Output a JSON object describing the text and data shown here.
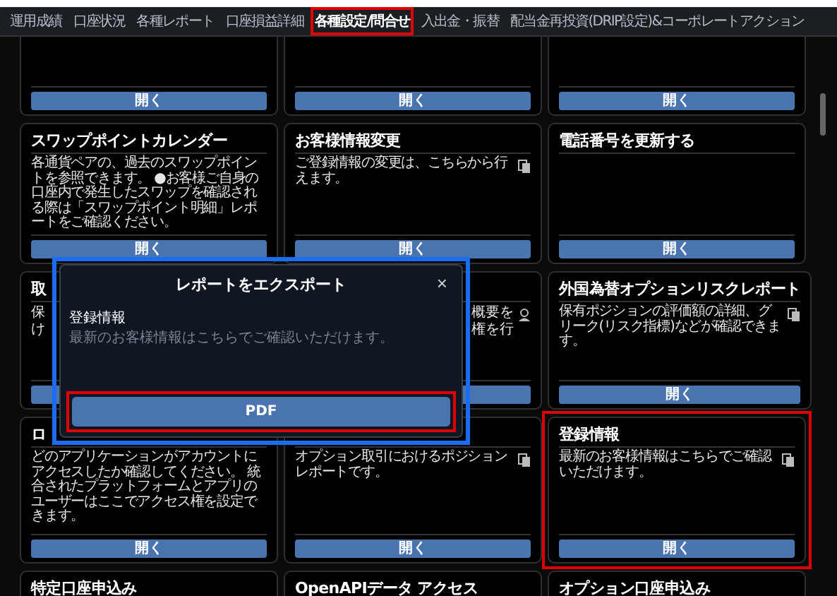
{
  "tabs": [
    {
      "label": "運用成績",
      "selected": false
    },
    {
      "label": "口座状況",
      "selected": false
    },
    {
      "label": "各種レポート",
      "selected": false
    },
    {
      "label": "口座損益詳細",
      "selected": false
    },
    {
      "label": "各種設定/問合せ",
      "selected": true,
      "annotated": true
    },
    {
      "label": "入出金・振替",
      "selected": false
    },
    {
      "label": "配当金再投資(DRIP設定)&コーポレートアクション",
      "selected": false
    }
  ],
  "cards": [
    {
      "kind": "plain",
      "button": "開く"
    },
    {
      "kind": "plain",
      "button": "開く"
    },
    {
      "kind": "plain",
      "button": "開く"
    },
    {
      "kind": "plain",
      "title": "スワップポイントカレンダー",
      "description": "各通貨ペアの、過去のスワップポイントを参照できます。 ●お客様ご自身の口座内で発生したスワップを確認される際は「スワップポイント明細」レポートをご確認ください。",
      "button": "開く"
    },
    {
      "kind": "copyable",
      "title": "お客様情報変更",
      "description": "ご登録情報の変更は、こちらから行えます。",
      "button": "開く"
    },
    {
      "kind": "plain",
      "title": "電話番号を更新する",
      "button": "開く"
    },
    {
      "kind": "plain",
      "title": "取",
      "fragments": [
        "保",
        "け"
      ]
    },
    {
      "kind": "account",
      "fragments": [
        "概要を",
        "権を行"
      ]
    },
    {
      "kind": "copyable",
      "title": "外国為替オプションリスクレポート",
      "description": "保有ポジションの評価額の詳細、グリーク(リスク指標)などが確認できます。",
      "button": "開く"
    },
    {
      "kind": "plain",
      "title": "ロ",
      "description": "どのアプリケーションがアカウントにアクセスしたか確認してください。 統合されたプラットフォームとアプリのユーザーはここでアクセス権を設定できます。",
      "button": "開く"
    },
    {
      "kind": "copyable",
      "description": "オプション取引におけるポジションレポートです。",
      "button": "開く"
    },
    {
      "kind": "copyable",
      "title": "登録情報",
      "description": "最新のお客様情報はこちらでご確認いただけます。",
      "button": "開く",
      "annotated": true
    },
    {
      "kind": "plain",
      "title": "特定口座申込み"
    },
    {
      "kind": "plain",
      "title": "OpenAPIデータ アクセス"
    },
    {
      "kind": "plain",
      "title": "オプション口座申込み"
    }
  ],
  "dialog": {
    "title": "レポートをエクスポート",
    "close": "×",
    "section_title": "登録情報",
    "section_text": "最新のお客様情報はこちらでご確認いただけます。",
    "button": "PDF",
    "annotated": true,
    "button_annotated": true
  }
}
